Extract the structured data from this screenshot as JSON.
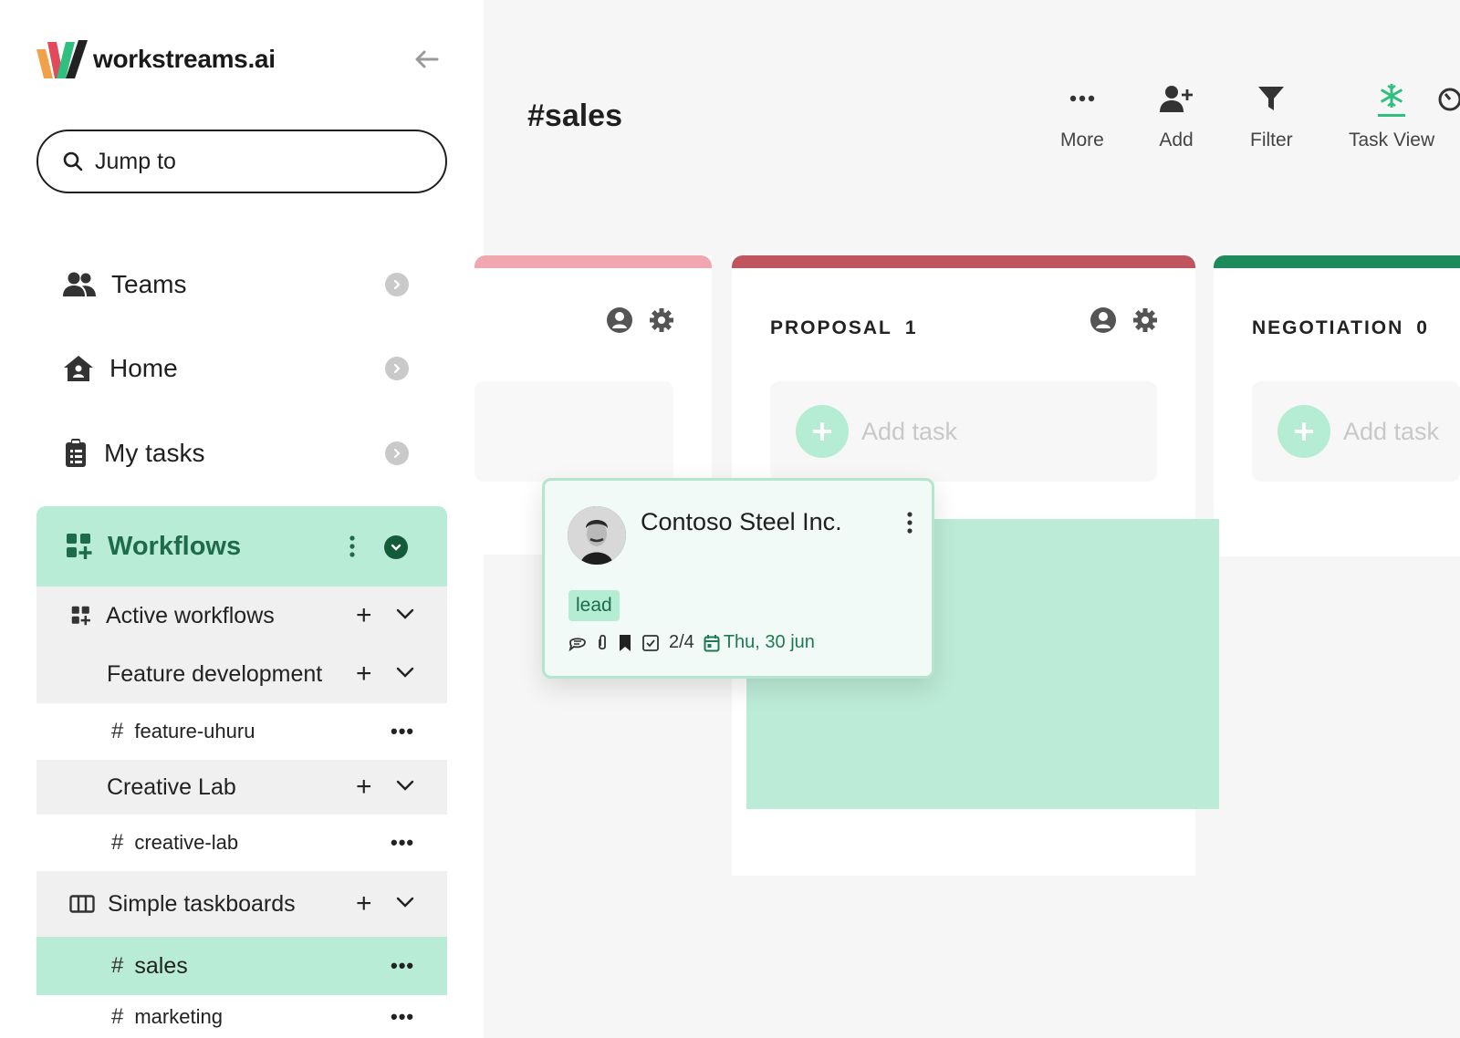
{
  "app": {
    "brand": "workstreams.ai",
    "colors": {
      "accent": "#2fbf7e",
      "accent_light": "#b9ecd6",
      "accent_dark": "#135c3a",
      "lead_bar": "#f0a7b0",
      "proposal_bar": "#c0555f",
      "negotiation_bar": "#1f8a5b"
    }
  },
  "sidebar": {
    "search_placeholder": "Jump to",
    "nav": [
      {
        "label": "Teams",
        "icon": "people-icon"
      },
      {
        "label": "Home",
        "icon": "home-icon"
      },
      {
        "label": "My tasks",
        "icon": "clipboard-icon"
      }
    ],
    "workflows": {
      "label": "Workflows",
      "groups": [
        {
          "label": "Active workflows"
        },
        {
          "label": "Feature development"
        },
        {
          "label": "Creative Lab"
        },
        {
          "label": "Simple taskboards"
        }
      ],
      "channels": [
        {
          "label": "feature-uhuru"
        },
        {
          "label": "creative-lab"
        },
        {
          "label": "sales"
        },
        {
          "label": "marketing"
        }
      ],
      "channel_prefix": "#",
      "more_symbol": "•••",
      "plus_symbol": "+"
    }
  },
  "header": {
    "title": "#sales",
    "tools": [
      {
        "label": "More",
        "icon": "more-icon"
      },
      {
        "label": "Add",
        "icon": "add-user-icon"
      },
      {
        "label": "Filter",
        "icon": "filter-icon"
      },
      {
        "label": "Task View",
        "icon": "snowflake-icon"
      }
    ]
  },
  "board": {
    "columns": [
      {
        "title": "",
        "count": ""
      },
      {
        "title": "PROPOSAL",
        "count": "1"
      },
      {
        "title": "NEGOTIATION",
        "count": "0"
      }
    ],
    "add_task_label": "Add task",
    "card": {
      "title": "Contoso Steel Inc.",
      "tag": "lead",
      "checklist": "2/4",
      "due": "Thu, 30 jun"
    }
  }
}
